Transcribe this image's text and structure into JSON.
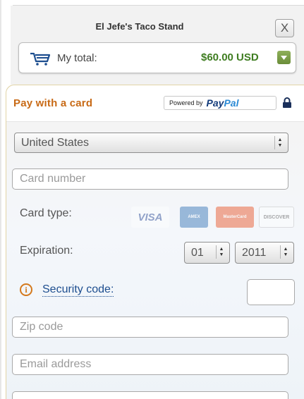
{
  "header": {
    "merchant_name": "El Jefe's Taco Stand",
    "close_label": "X"
  },
  "total": {
    "label": "My total:",
    "amount": "$60.00 USD"
  },
  "card_section": {
    "title": "Pay with a card",
    "powered_by": "Powered by",
    "paypal_pay": "Pay",
    "paypal_pal": "Pal"
  },
  "form": {
    "country": "United States",
    "card_number_placeholder": "Card number",
    "card_type_label": "Card type:",
    "card_brands": [
      "VISA",
      "AMEX",
      "MasterCard",
      "DISCOVER"
    ],
    "expiration_label": "Expiration:",
    "expiration_month": "01",
    "expiration_year": "2011",
    "security_code_label": "Security code:",
    "zip_placeholder": "Zip code",
    "email_placeholder": "Email address"
  },
  "colors": {
    "accent_orange": "#c86a16",
    "total_green": "#3f7d21",
    "link_blue": "#1d4e8f"
  }
}
